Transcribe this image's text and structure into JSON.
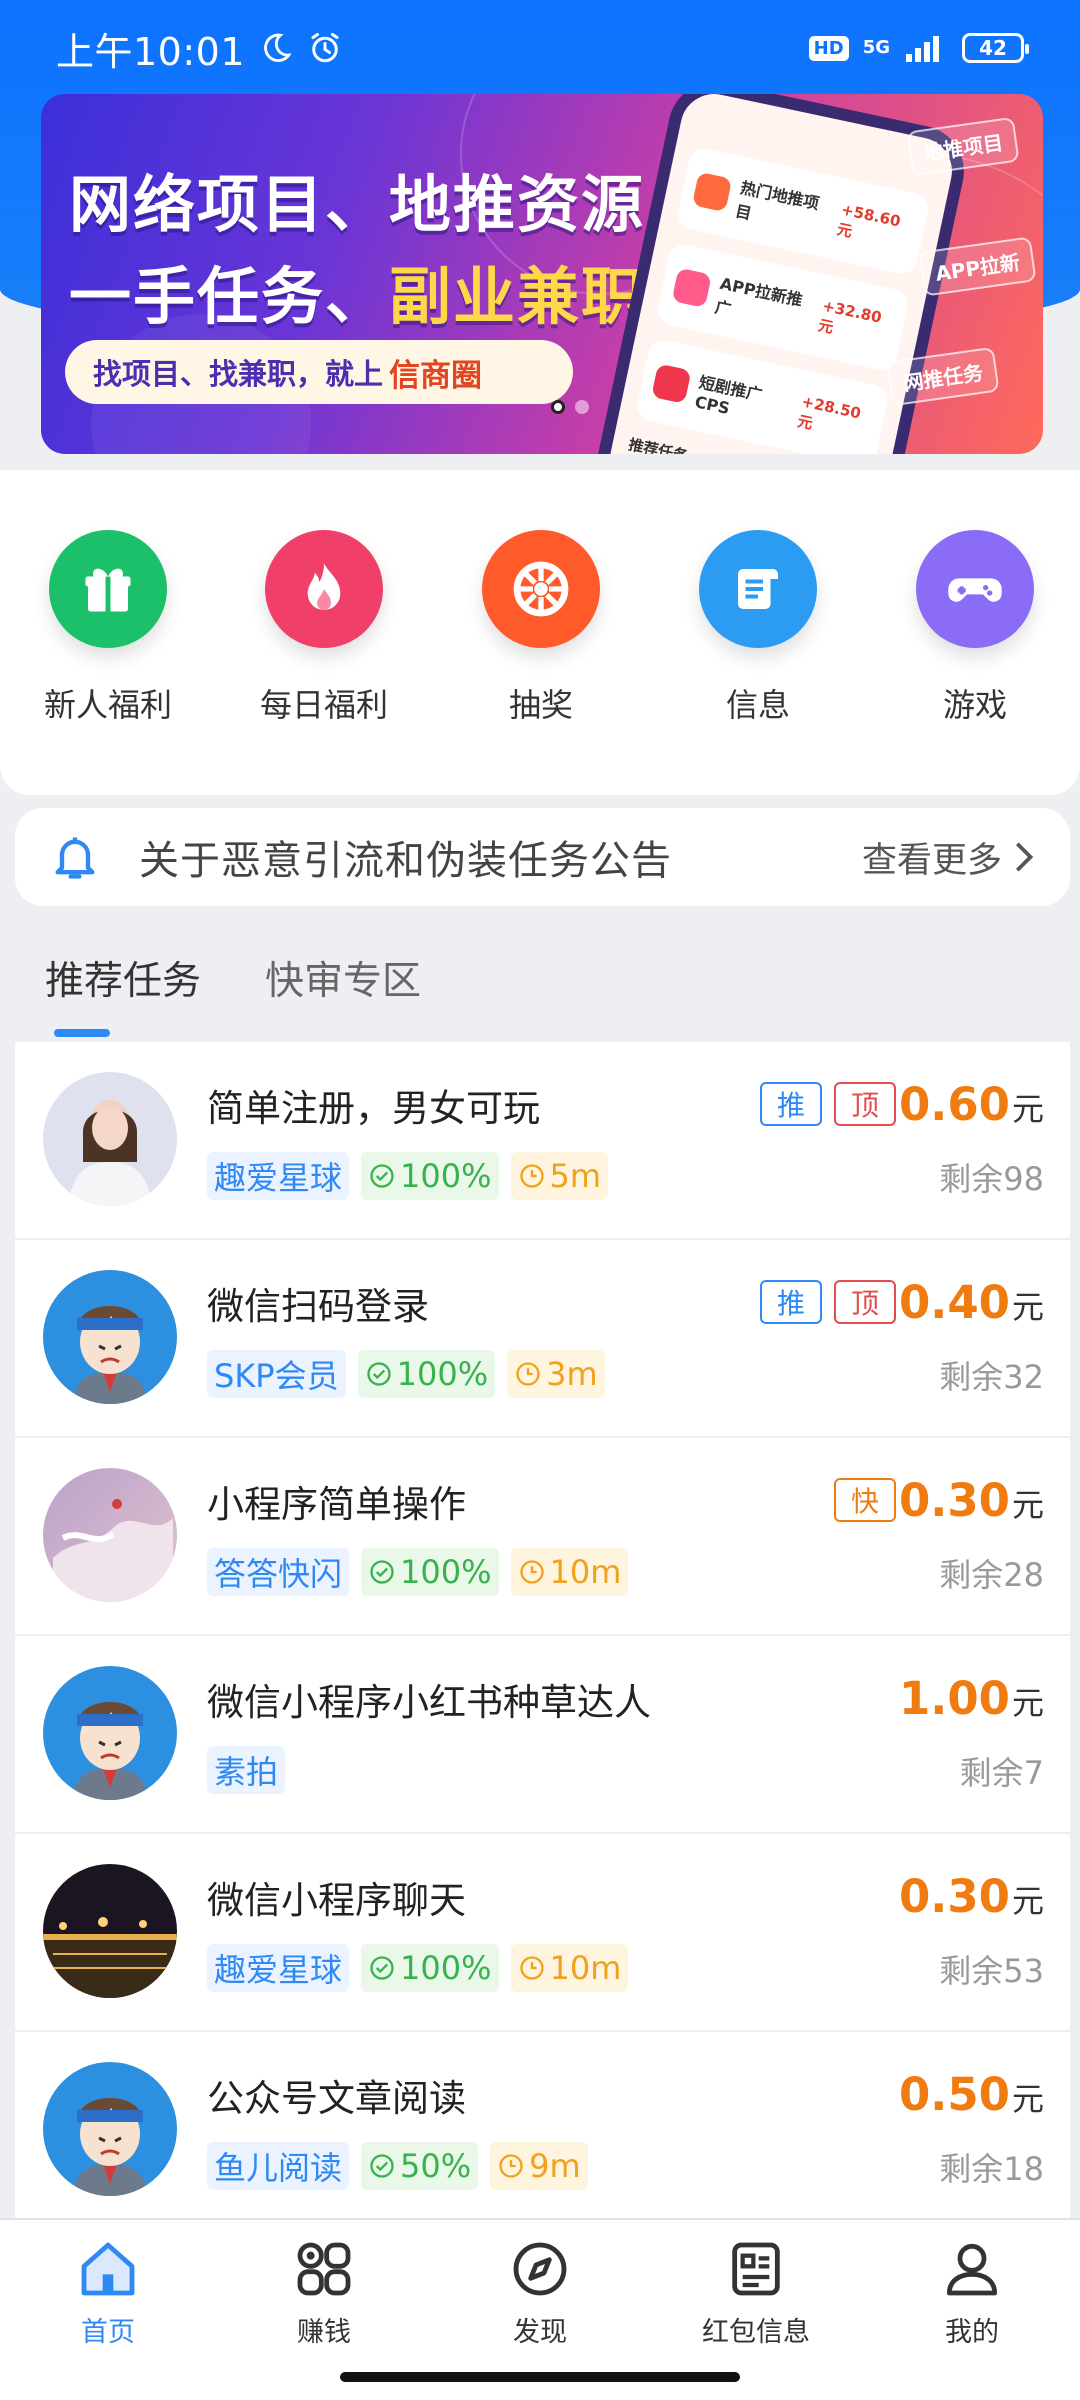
{
  "status": {
    "time": "上午10:01",
    "hd": "HD",
    "network": "5G",
    "battery": "42"
  },
  "banner": {
    "line1": "网络项目、地推资源",
    "line2_prefix": "一手任务、",
    "line2_highlight": "副业兼职",
    "pill_text": "找项目、找兼职，就上",
    "pill_brand": "信商圈",
    "phone_rows": [
      {
        "title": "热门地推项目",
        "amount": "+58.60元"
      },
      {
        "title": "APP拉新推广",
        "amount": "+32.80元"
      },
      {
        "title": "短剧推广CPS",
        "amount": "+28.50元"
      }
    ],
    "phone_section": "推荐任务",
    "float_tags": [
      "地推项目",
      "APP拉新",
      "网推任务"
    ],
    "active_slide": 0,
    "slide_count": 2
  },
  "quick": [
    {
      "label": "新人福利",
      "icon": "gift-icon",
      "color": "#1cc06b"
    },
    {
      "label": "每日福利",
      "icon": "flame-icon",
      "color": "#f0406a"
    },
    {
      "label": "抽奖",
      "icon": "wheel-icon",
      "color": "#ff5a2a"
    },
    {
      "label": "信息",
      "icon": "scroll-icon",
      "color": "#2b9cf2"
    },
    {
      "label": "游戏",
      "icon": "gamepad-icon",
      "color": "#8a6cf6"
    }
  ],
  "notice": {
    "text": "关于恶意引流和伪装任务公告",
    "more": "查看更多"
  },
  "tabs": [
    "推荐任务",
    "快审专区"
  ],
  "tasks": [
    {
      "title": "简单注册，男女可玩",
      "source": "趣爱星球",
      "rate": "100%",
      "time": "5m",
      "price": "0.60",
      "unit": "元",
      "remain": "剩余98",
      "badges": [
        "推",
        "顶"
      ]
    },
    {
      "title": "微信扫码登录",
      "source": "SKP会员",
      "rate": "100%",
      "time": "3m",
      "price": "0.40",
      "unit": "元",
      "remain": "剩余32",
      "badges": [
        "推",
        "顶"
      ]
    },
    {
      "title": "小程序简单操作",
      "source": "答答快闪",
      "rate": "100%",
      "time": "10m",
      "price": "0.30",
      "unit": "元",
      "remain": "剩余28",
      "badges": [
        "快"
      ]
    },
    {
      "title": "微信小程序小红书种草达人",
      "source": "素拍",
      "price": "1.00",
      "unit": "元",
      "remain": "剩余7",
      "badges": []
    },
    {
      "title": "微信小程序聊天",
      "source": "趣爱星球",
      "rate": "100%",
      "time": "10m",
      "price": "0.30",
      "unit": "元",
      "remain": "剩余53",
      "badges": []
    },
    {
      "title": "公众号文章阅读",
      "source": "鱼儿阅读",
      "rate": "50%",
      "time": "9m",
      "price": "0.50",
      "unit": "元",
      "remain": "剩余18",
      "badges": []
    }
  ],
  "nav": [
    {
      "label": "首页",
      "icon": "home-icon"
    },
    {
      "label": "赚钱",
      "icon": "grid-icon"
    },
    {
      "label": "发现",
      "icon": "compass-icon"
    },
    {
      "label": "红包信息",
      "icon": "news-icon"
    },
    {
      "label": "我的",
      "icon": "user-icon"
    }
  ],
  "nav_active": 0,
  "colors": {
    "primary": "#2f89f5",
    "header_blue": "#0d72ff",
    "price_orange": "#f07b10"
  }
}
